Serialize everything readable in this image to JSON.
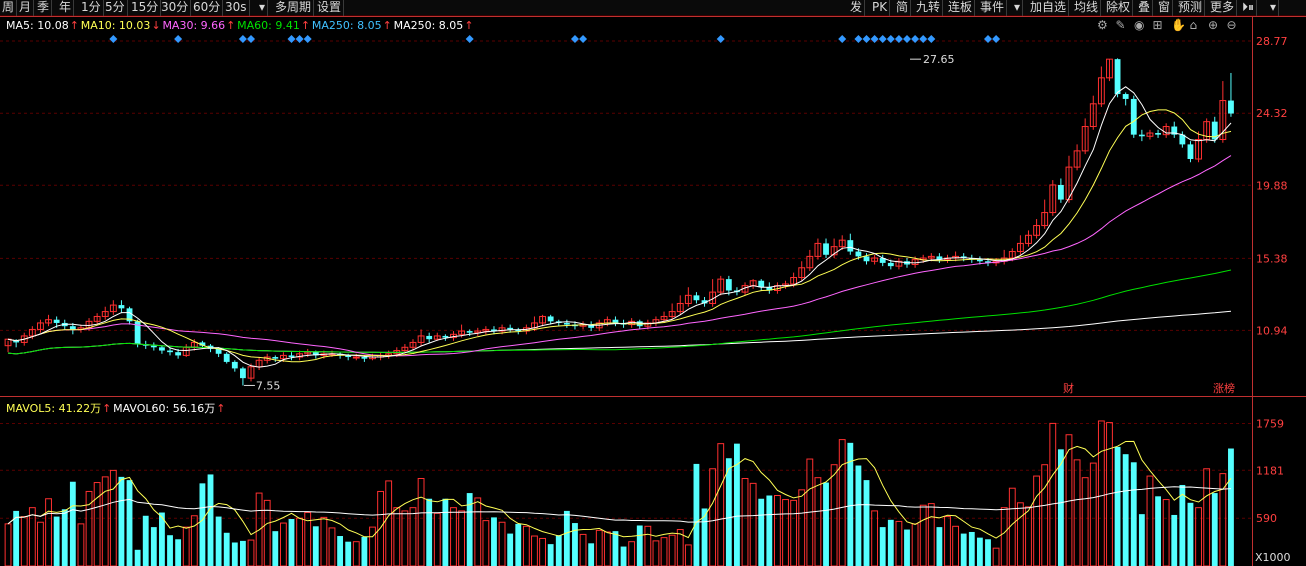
{
  "toolbar": {
    "left": [
      "周",
      "月",
      "季",
      "年",
      "1分",
      "5分",
      "15分",
      "30分",
      "60分",
      "30s",
      "▾",
      "多周期",
      "设置"
    ],
    "right": [
      "发",
      "PK",
      "简",
      "九转",
      "连板",
      "事件",
      "▾",
      "加自选",
      "均线",
      "除权",
      "叠",
      "窗",
      "预测",
      "更多",
      "⏵⏸",
      "▾"
    ]
  },
  "ma_legend": [
    {
      "label": "MA5: 10.08",
      "arrow": "↑",
      "color": "#ffffff"
    },
    {
      "label": "MA10: 10.03",
      "arrow": "↓",
      "color": "#ffff55"
    },
    {
      "label": "MA30: 9.66",
      "arrow": "↑",
      "color": "#ff66ff"
    },
    {
      "label": "MA60: 9.41",
      "arrow": "↑",
      "color": "#00e000"
    },
    {
      "label": "MA250: 8.05",
      "arrow": "↑",
      "color": "#40c0ff"
    },
    {
      "label": "MA250: 8.05",
      "arrow": "↑",
      "color": "#ffffff"
    }
  ],
  "vol_legend": [
    {
      "label": "MAVOL5: 41.22万",
      "arrow": "↑",
      "color": "#ffff55"
    },
    {
      "label": "MAVOL60: 56.16万",
      "arrow": "↑",
      "color": "#ffffff"
    }
  ],
  "annotations": {
    "high": "27.65",
    "low": "7.55",
    "cai": "财",
    "zhangbang": "涨榜",
    "unit": "X1000"
  },
  "colors": {
    "up": "#ff3030",
    "down": "#55ffff",
    "grid": "#5a0000",
    "axis": "#c03030"
  },
  "chart_data": {
    "type": "candlestick",
    "price_axis_ticks": [
      28.77,
      24.32,
      19.88,
      15.38,
      10.94
    ],
    "volume_axis_ticks": [
      1759,
      1181,
      590
    ],
    "candles": [
      [
        10.0,
        10.4,
        9.6,
        10.3,
        520
      ],
      [
        10.3,
        10.2,
        9.9,
        10.4,
        680
      ],
      [
        10.2,
        10.6,
        10.0,
        10.8,
        610
      ],
      [
        10.6,
        11.0,
        10.4,
        11.2,
        720
      ],
      [
        11.0,
        11.4,
        10.8,
        11.6,
        540
      ],
      [
        11.4,
        11.6,
        11.2,
        11.9,
        830
      ],
      [
        11.6,
        11.4,
        11.1,
        11.8,
        610
      ],
      [
        11.4,
        11.2,
        11.0,
        11.6,
        700
      ],
      [
        11.2,
        11.0,
        10.7,
        11.4,
        1040
      ],
      [
        11.0,
        11.1,
        10.8,
        11.3,
        520
      ],
      [
        11.1,
        11.5,
        10.9,
        11.7,
        920
      ],
      [
        11.5,
        11.8,
        11.3,
        12.0,
        1030
      ],
      [
        11.8,
        12.1,
        11.6,
        12.4,
        1100
      ],
      [
        12.1,
        12.5,
        11.9,
        12.8,
        1180
      ],
      [
        12.5,
        12.3,
        12.0,
        12.8,
        1100
      ],
      [
        12.3,
        11.5,
        11.3,
        12.4,
        1060
      ],
      [
        11.5,
        10.1,
        9.9,
        11.6,
        200
      ],
      [
        10.1,
        10.0,
        9.8,
        10.3,
        620
      ],
      [
        10.0,
        9.9,
        9.7,
        10.2,
        480
      ],
      [
        9.9,
        9.7,
        9.5,
        10.0,
        660
      ],
      [
        9.7,
        9.6,
        9.4,
        9.9,
        380
      ],
      [
        9.6,
        9.4,
        9.2,
        9.8,
        330
      ],
      [
        9.4,
        9.9,
        9.3,
        10.1,
        480
      ],
      [
        9.9,
        10.2,
        9.7,
        10.4,
        620
      ],
      [
        10.2,
        10.0,
        9.8,
        10.3,
        1020
      ],
      [
        10.0,
        9.8,
        9.6,
        10.1,
        1130
      ],
      [
        9.8,
        9.5,
        9.3,
        9.9,
        610
      ],
      [
        9.5,
        9.0,
        8.9,
        9.6,
        410
      ],
      [
        9.0,
        8.6,
        8.4,
        9.1,
        290
      ],
      [
        8.6,
        8.0,
        7.55,
        8.7,
        310
      ],
      [
        8.0,
        8.7,
        7.8,
        8.9,
        320
      ],
      [
        8.7,
        9.1,
        8.5,
        9.3,
        900
      ],
      [
        9.1,
        9.3,
        8.9,
        9.5,
        810
      ],
      [
        9.3,
        9.2,
        9.0,
        9.4,
        430
      ],
      [
        9.2,
        9.4,
        9.0,
        9.6,
        530
      ],
      [
        9.4,
        9.3,
        9.1,
        9.6,
        580
      ],
      [
        9.3,
        9.5,
        9.1,
        9.7,
        590
      ],
      [
        9.5,
        9.6,
        9.3,
        9.8,
        660
      ],
      [
        9.6,
        9.4,
        9.2,
        9.7,
        490
      ],
      [
        9.4,
        9.5,
        9.2,
        9.7,
        600
      ],
      [
        9.5,
        9.5,
        9.3,
        9.7,
        470
      ],
      [
        9.5,
        9.4,
        9.2,
        9.6,
        370
      ],
      [
        9.4,
        9.3,
        9.1,
        9.5,
        300
      ],
      [
        9.3,
        9.3,
        9.1,
        9.5,
        300
      ],
      [
        9.3,
        9.2,
        9.0,
        9.4,
        360
      ],
      [
        9.2,
        9.3,
        9.1,
        9.5,
        480
      ],
      [
        9.3,
        9.4,
        9.1,
        9.6,
        920
      ],
      [
        9.4,
        9.5,
        9.2,
        9.7,
        1050
      ],
      [
        9.5,
        9.7,
        9.3,
        9.9,
        720
      ],
      [
        9.7,
        9.9,
        9.5,
        10.1,
        680
      ],
      [
        9.9,
        10.2,
        9.7,
        10.4,
        720
      ],
      [
        10.2,
        10.6,
        10.0,
        11.0,
        1080
      ],
      [
        10.6,
        10.4,
        10.2,
        10.8,
        830
      ],
      [
        10.4,
        10.6,
        10.3,
        10.8,
        650
      ],
      [
        10.6,
        10.5,
        10.3,
        10.7,
        830
      ],
      [
        10.5,
        10.7,
        10.3,
        10.9,
        720
      ],
      [
        10.7,
        10.9,
        10.5,
        11.3,
        680
      ],
      [
        10.9,
        10.8,
        10.6,
        11.0,
        900
      ],
      [
        10.8,
        10.9,
        10.6,
        11.1,
        840
      ],
      [
        10.9,
        11.0,
        10.7,
        11.2,
        560
      ],
      [
        11.0,
        10.9,
        10.7,
        11.2,
        600
      ],
      [
        10.9,
        11.1,
        10.7,
        11.3,
        540
      ],
      [
        11.1,
        11.0,
        10.8,
        11.3,
        400
      ],
      [
        11.0,
        10.9,
        10.7,
        11.1,
        520
      ],
      [
        10.9,
        11.1,
        10.7,
        11.3,
        490
      ],
      [
        11.1,
        11.4,
        10.9,
        11.8,
        370
      ],
      [
        11.4,
        11.8,
        11.2,
        11.9,
        340
      ],
      [
        11.8,
        11.5,
        11.3,
        11.9,
        270
      ],
      [
        11.5,
        11.4,
        11.2,
        11.6,
        380
      ],
      [
        11.4,
        11.3,
        11.1,
        11.6,
        680
      ],
      [
        11.3,
        11.2,
        11.0,
        11.5,
        530
      ],
      [
        11.2,
        11.3,
        11.0,
        11.5,
        390
      ],
      [
        11.3,
        11.1,
        10.9,
        11.5,
        280
      ],
      [
        11.1,
        11.4,
        10.9,
        11.6,
        440
      ],
      [
        11.4,
        11.6,
        11.2,
        11.8,
        420
      ],
      [
        11.6,
        11.4,
        11.2,
        11.8,
        430
      ],
      [
        11.4,
        11.3,
        11.1,
        11.6,
        240
      ],
      [
        11.3,
        11.5,
        11.1,
        11.7,
        300
      ],
      [
        11.5,
        11.2,
        11.0,
        11.6,
        500
      ],
      [
        11.2,
        11.4,
        11.0,
        11.6,
        490
      ],
      [
        11.4,
        11.6,
        11.2,
        11.8,
        310
      ],
      [
        11.6,
        11.8,
        11.4,
        12.1,
        350
      ],
      [
        11.8,
        12.1,
        11.6,
        12.6,
        380
      ],
      [
        12.1,
        12.6,
        11.9,
        13.1,
        450
      ],
      [
        12.6,
        13.1,
        12.4,
        13.6,
        260
      ],
      [
        13.1,
        12.8,
        12.6,
        13.3,
        1260
      ],
      [
        12.8,
        12.6,
        12.4,
        13.0,
        710
      ],
      [
        12.6,
        13.3,
        12.4,
        14.1,
        1200
      ],
      [
        13.3,
        14.1,
        13.1,
        14.3,
        1510
      ],
      [
        14.1,
        13.4,
        13.1,
        14.3,
        1330
      ],
      [
        13.4,
        13.3,
        13.1,
        13.6,
        1510
      ],
      [
        13.3,
        13.7,
        13.1,
        13.9,
        1080
      ],
      [
        13.7,
        14.0,
        13.5,
        14.1,
        1020
      ],
      [
        14.0,
        13.6,
        13.4,
        14.1,
        830
      ],
      [
        13.6,
        13.4,
        13.2,
        13.9,
        870
      ],
      [
        13.4,
        13.7,
        13.2,
        13.9,
        870
      ],
      [
        13.7,
        13.8,
        13.5,
        14.0,
        820
      ],
      [
        13.8,
        14.2,
        13.6,
        14.5,
        810
      ],
      [
        14.2,
        14.8,
        14.0,
        15.2,
        940
      ],
      [
        14.8,
        15.5,
        14.6,
        15.9,
        1320
      ],
      [
        15.5,
        16.3,
        15.3,
        16.6,
        1090
      ],
      [
        16.3,
        15.6,
        15.4,
        16.6,
        1030
      ],
      [
        15.6,
        16.1,
        15.4,
        16.6,
        1250
      ],
      [
        16.1,
        16.5,
        15.9,
        16.8,
        1560
      ],
      [
        16.5,
        15.8,
        15.6,
        16.9,
        1520
      ],
      [
        15.8,
        15.5,
        15.3,
        16.0,
        1240
      ],
      [
        15.5,
        15.2,
        15.0,
        15.7,
        1060
      ],
      [
        15.2,
        15.4,
        15.0,
        15.6,
        680
      ],
      [
        15.4,
        15.1,
        14.9,
        15.6,
        480
      ],
      [
        15.1,
        14.9,
        14.7,
        15.3,
        570
      ],
      [
        14.9,
        15.2,
        14.7,
        15.4,
        550
      ],
      [
        15.2,
        15.0,
        14.8,
        15.4,
        450
      ],
      [
        15.0,
        15.3,
        14.8,
        15.5,
        520
      ],
      [
        15.3,
        15.4,
        15.1,
        15.6,
        750
      ],
      [
        15.4,
        15.5,
        15.2,
        15.7,
        770
      ],
      [
        15.5,
        15.3,
        15.1,
        15.7,
        480
      ],
      [
        15.3,
        15.4,
        15.1,
        15.6,
        610
      ],
      [
        15.4,
        15.5,
        15.2,
        15.8,
        490
      ],
      [
        15.5,
        15.4,
        15.2,
        15.7,
        400
      ],
      [
        15.4,
        15.3,
        15.1,
        15.6,
        420
      ],
      [
        15.3,
        15.2,
        15.0,
        15.5,
        350
      ],
      [
        15.2,
        15.1,
        14.9,
        15.4,
        330
      ],
      [
        15.1,
        15.2,
        14.9,
        15.4,
        220
      ],
      [
        15.2,
        15.4,
        15.0,
        15.9,
        720
      ],
      [
        15.4,
        15.8,
        15.2,
        16.0,
        960
      ],
      [
        15.8,
        16.3,
        15.6,
        16.8,
        780
      ],
      [
        16.3,
        16.8,
        16.1,
        17.1,
        730
      ],
      [
        16.8,
        17.4,
        16.6,
        17.8,
        1110
      ],
      [
        17.4,
        18.2,
        17.2,
        19.0,
        1250
      ],
      [
        18.2,
        19.9,
        18.0,
        20.2,
        1760
      ],
      [
        19.9,
        19.0,
        18.8,
        20.3,
        1440
      ],
      [
        19.0,
        21.0,
        18.8,
        21.7,
        1620
      ],
      [
        21.0,
        22.0,
        20.8,
        22.4,
        1310
      ],
      [
        22.0,
        23.5,
        21.8,
        24.0,
        1090
      ],
      [
        23.5,
        24.9,
        23.3,
        25.4,
        1270
      ],
      [
        24.9,
        26.5,
        24.7,
        27.2,
        1790
      ],
      [
        26.5,
        27.65,
        26.3,
        27.65,
        1770
      ],
      [
        27.65,
        25.5,
        25.3,
        27.7,
        1470
      ],
      [
        25.5,
        25.2,
        24.8,
        25.6,
        1380
      ],
      [
        25.2,
        23.0,
        22.8,
        25.4,
        1280
      ],
      [
        23.0,
        22.9,
        22.6,
        23.3,
        640
      ],
      [
        22.9,
        23.1,
        22.7,
        23.3,
        1110
      ],
      [
        23.1,
        23.0,
        22.8,
        23.3,
        860
      ],
      [
        23.0,
        23.5,
        22.8,
        23.7,
        820
      ],
      [
        23.5,
        23.0,
        22.8,
        23.8,
        630
      ],
      [
        23.0,
        22.4,
        22.2,
        23.2,
        1000
      ],
      [
        22.4,
        21.5,
        21.3,
        22.6,
        780
      ],
      [
        21.5,
        22.7,
        21.3,
        23.2,
        720
      ],
      [
        22.7,
        23.8,
        22.5,
        24.0,
        1200
      ],
      [
        23.8,
        22.7,
        22.5,
        24.1,
        900
      ],
      [
        22.7,
        25.1,
        22.5,
        26.3,
        1140
      ],
      [
        25.1,
        24.3,
        24.1,
        26.8,
        1450
      ]
    ]
  }
}
